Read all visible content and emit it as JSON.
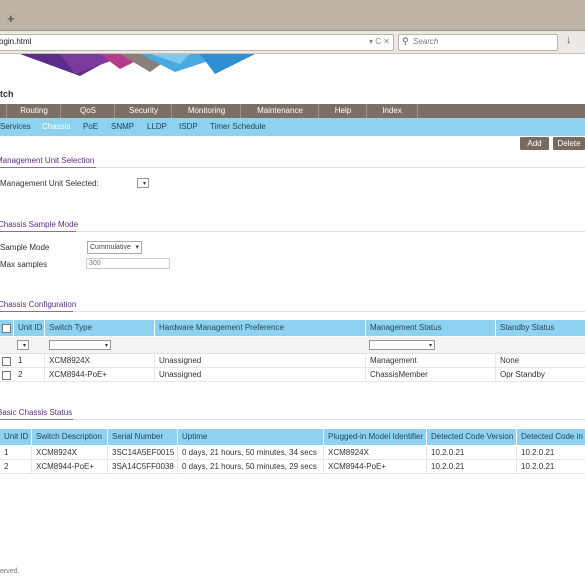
{
  "browser": {
    "new_tab_label": "+",
    "url": "ogin.html",
    "url_icons": "▾ C  ✕",
    "search_placeholder": "Search",
    "download_icon": "download-icon"
  },
  "brand": {
    "title": "tch"
  },
  "nav_main": [
    "Routing",
    "QoS",
    "Security",
    "Monitoring",
    "Maintenance",
    "Help",
    "Index"
  ],
  "nav_sub": {
    "items": [
      "Services",
      "Chassis",
      "PoE",
      "SNMP",
      "LLDP",
      "ISDP",
      "Timer Schedule"
    ],
    "active": "Chassis"
  },
  "actions": {
    "add": "Add",
    "delete": "Delete"
  },
  "mgmt_unit": {
    "section_title": "Management Unit Selection",
    "label": "Management Unit Selected:",
    "value": ""
  },
  "sample_mode": {
    "section_title": "Chassis Sample Mode",
    "mode_label": "Sample Mode",
    "mode_value": "Cummulative",
    "max_label": "Max samples",
    "max_placeholder": "300"
  },
  "chassis_config": {
    "section_title": "Chassis Configuration",
    "columns": [
      "Unit ID",
      "Switch Type",
      "Hardware Management Preference",
      "Management Status",
      "Standby Status"
    ],
    "rows": [
      [
        "1",
        "XCM8924X",
        "Unassigned",
        "Management",
        "None"
      ],
      [
        "2",
        "XCM8944-PoE+",
        "Unassigned",
        "ChassisMember",
        "Opr Standby"
      ]
    ]
  },
  "basic_status": {
    "section_title": "Basic Chassis Status",
    "columns": [
      "Unit ID",
      "Switch Description",
      "Serial Number",
      "Uptime",
      "Plugged-in Model Identifier",
      "Detected Code Version",
      "Detected Code in"
    ],
    "rows": [
      [
        "1",
        "XCM8924X",
        "3SC14A5EF0015",
        "0 days, 21 hours, 50 minutes, 34 secs",
        "XCM8924X",
        "10.2.0.21",
        "10.2.0.21"
      ],
      [
        "2",
        "XCM8944-PoE+",
        "3SA14C5FF0038",
        "0 days, 21 hours, 50 minutes, 29 secs",
        "XCM8944-PoE+",
        "10.2.0.21",
        "10.2.0.21"
      ]
    ]
  },
  "footer": {
    "text": "erved."
  },
  "colors": {
    "nav_main": "#7b6f66",
    "nav_sub": "#8ed2ef",
    "accent": "#5b2c82",
    "button": "#766a61"
  }
}
